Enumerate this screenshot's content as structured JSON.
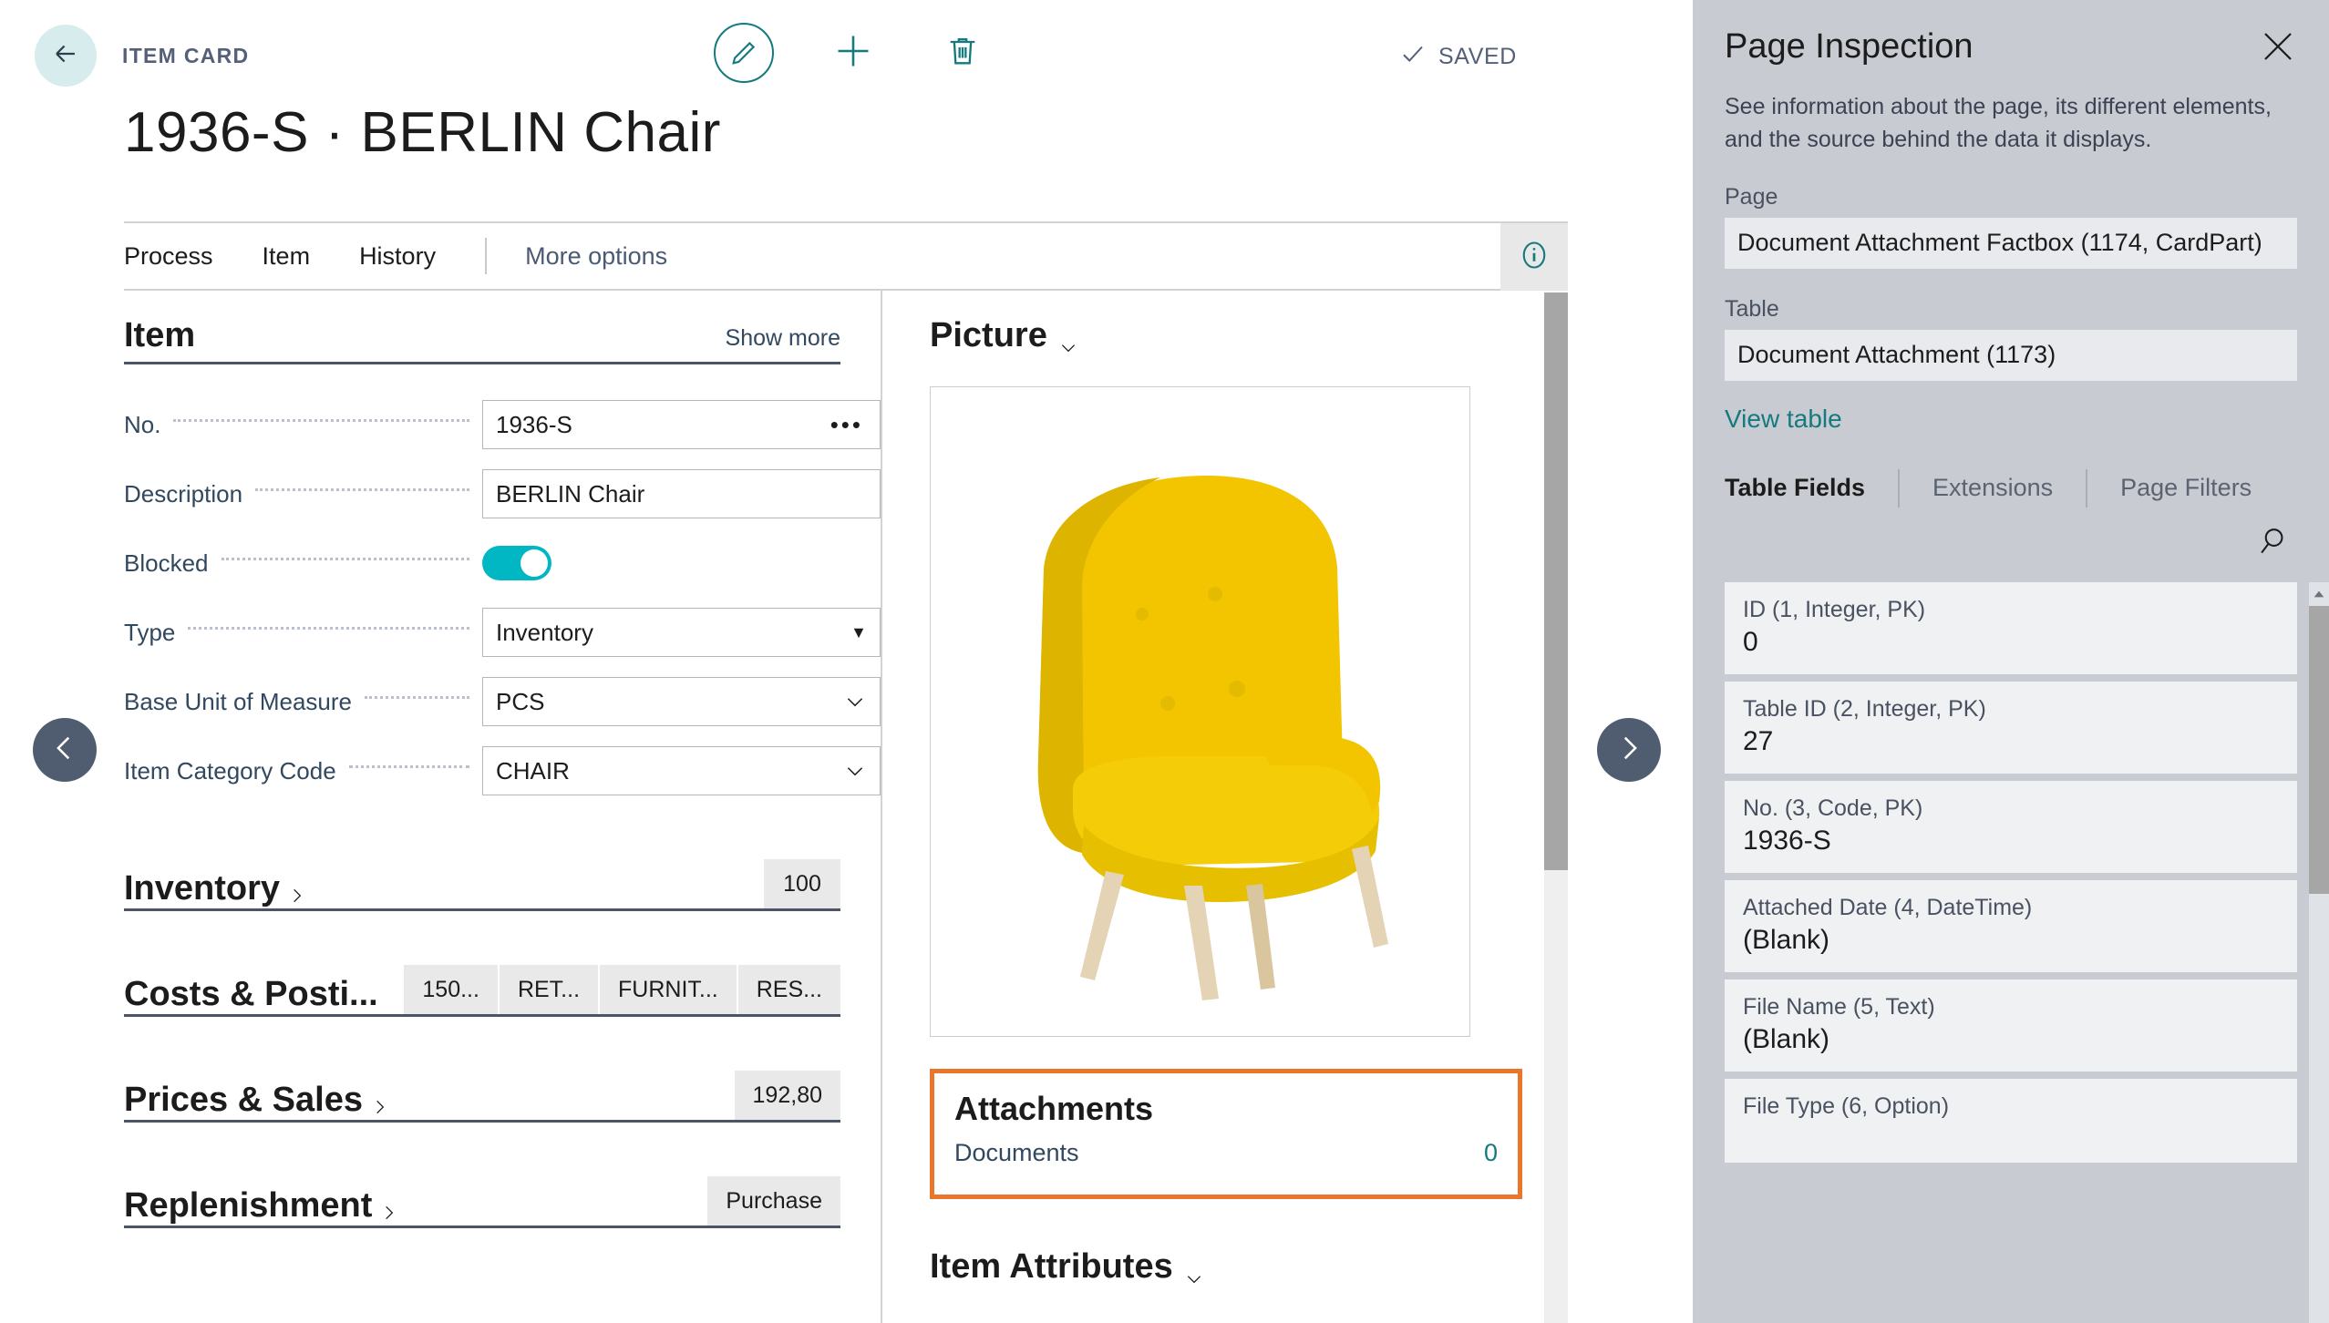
{
  "topbar": {
    "back_icon": "arrow-left-icon",
    "breadcrumb": "ITEM CARD",
    "edit_icon": "pencil-icon",
    "new_icon": "plus-icon",
    "delete_icon": "trash-icon",
    "saved_label": "SAVED",
    "saved_icon": "checkmark-icon"
  },
  "page_title": "1936-S · BERLIN Chair",
  "ribbon": {
    "items": [
      {
        "label": "Process"
      },
      {
        "label": "Item"
      },
      {
        "label": "History"
      }
    ],
    "more_options": "More options",
    "info_icon": "info-icon"
  },
  "item_group": {
    "title": "Item",
    "show_more": "Show more",
    "fields": [
      {
        "label": "No.",
        "value": "1936-S",
        "control": "text-assist",
        "assist_glyph": "•••"
      },
      {
        "label": "Description",
        "value": "BERLIN Chair",
        "control": "text"
      },
      {
        "label": "Blocked",
        "value": "On",
        "control": "toggle"
      },
      {
        "label": "Type",
        "value": "Inventory",
        "control": "select",
        "caret": "▼"
      },
      {
        "label": "Base Unit of Measure",
        "value": "PCS",
        "control": "lookup"
      },
      {
        "label": "Item Category Code",
        "value": "CHAIR",
        "control": "lookup"
      }
    ]
  },
  "collapsed_groups": [
    {
      "title": "Inventory",
      "chevron": "chevron-right-icon",
      "values": [
        "100"
      ]
    },
    {
      "title": "Costs & Posti...",
      "chevron": "",
      "values": [
        "150...",
        "RET...",
        "FURNIT...",
        "RES..."
      ]
    },
    {
      "title": "Prices & Sales",
      "chevron": "chevron-right-icon",
      "values": [
        "192,80"
      ]
    },
    {
      "title": "Replenishment",
      "chevron": "chevron-right-icon",
      "values": [
        "Purchase"
      ]
    }
  ],
  "right_column": {
    "picture_title": "Picture",
    "picture_chevron": "chevron-down-icon",
    "picture_alt": "yellow-armchair-image",
    "attachments": {
      "title": "Attachments",
      "row_label": "Documents",
      "row_value": "0",
      "highlight_color": "#e8762b"
    },
    "item_attributes_title": "Item Attributes",
    "item_attributes_chevron": "chevron-down-icon"
  },
  "page_nav": {
    "prev_icon": "chevron-left-icon",
    "next_icon": "chevron-right-icon"
  },
  "inspection": {
    "title": "Page Inspection",
    "close_icon": "close-icon",
    "description": "See information about the page, its different elements, and the source behind the data it displays.",
    "page_label": "Page",
    "page_value": "Document Attachment Factbox (1174, CardPart)",
    "table_label": "Table",
    "table_value": "Document Attachment (1173)",
    "view_table_link": "View table",
    "search_icon": "search-icon",
    "tabs": [
      {
        "label": "Table Fields",
        "active": true
      },
      {
        "label": "Extensions",
        "active": false
      },
      {
        "label": "Page Filters",
        "active": false
      }
    ],
    "fields": [
      {
        "key": "ID (1, Integer, PK)",
        "value": "0"
      },
      {
        "key": "Table ID (2, Integer, PK)",
        "value": "27"
      },
      {
        "key": "No. (3, Code, PK)",
        "value": "1936-S"
      },
      {
        "key": "Attached Date (4, DateTime)",
        "value": "(Blank)"
      },
      {
        "key": "File Name (5, Text)",
        "value": "(Blank)"
      },
      {
        "key": "File Type (6, Option)",
        "value": ""
      }
    ]
  },
  "colors": {
    "accent_teal": "#157a7f",
    "toggle_on": "#00b7c3",
    "highlight_orange": "#e8762b",
    "panel_bg": "#c8ccd2",
    "label_blue": "#31485f"
  }
}
